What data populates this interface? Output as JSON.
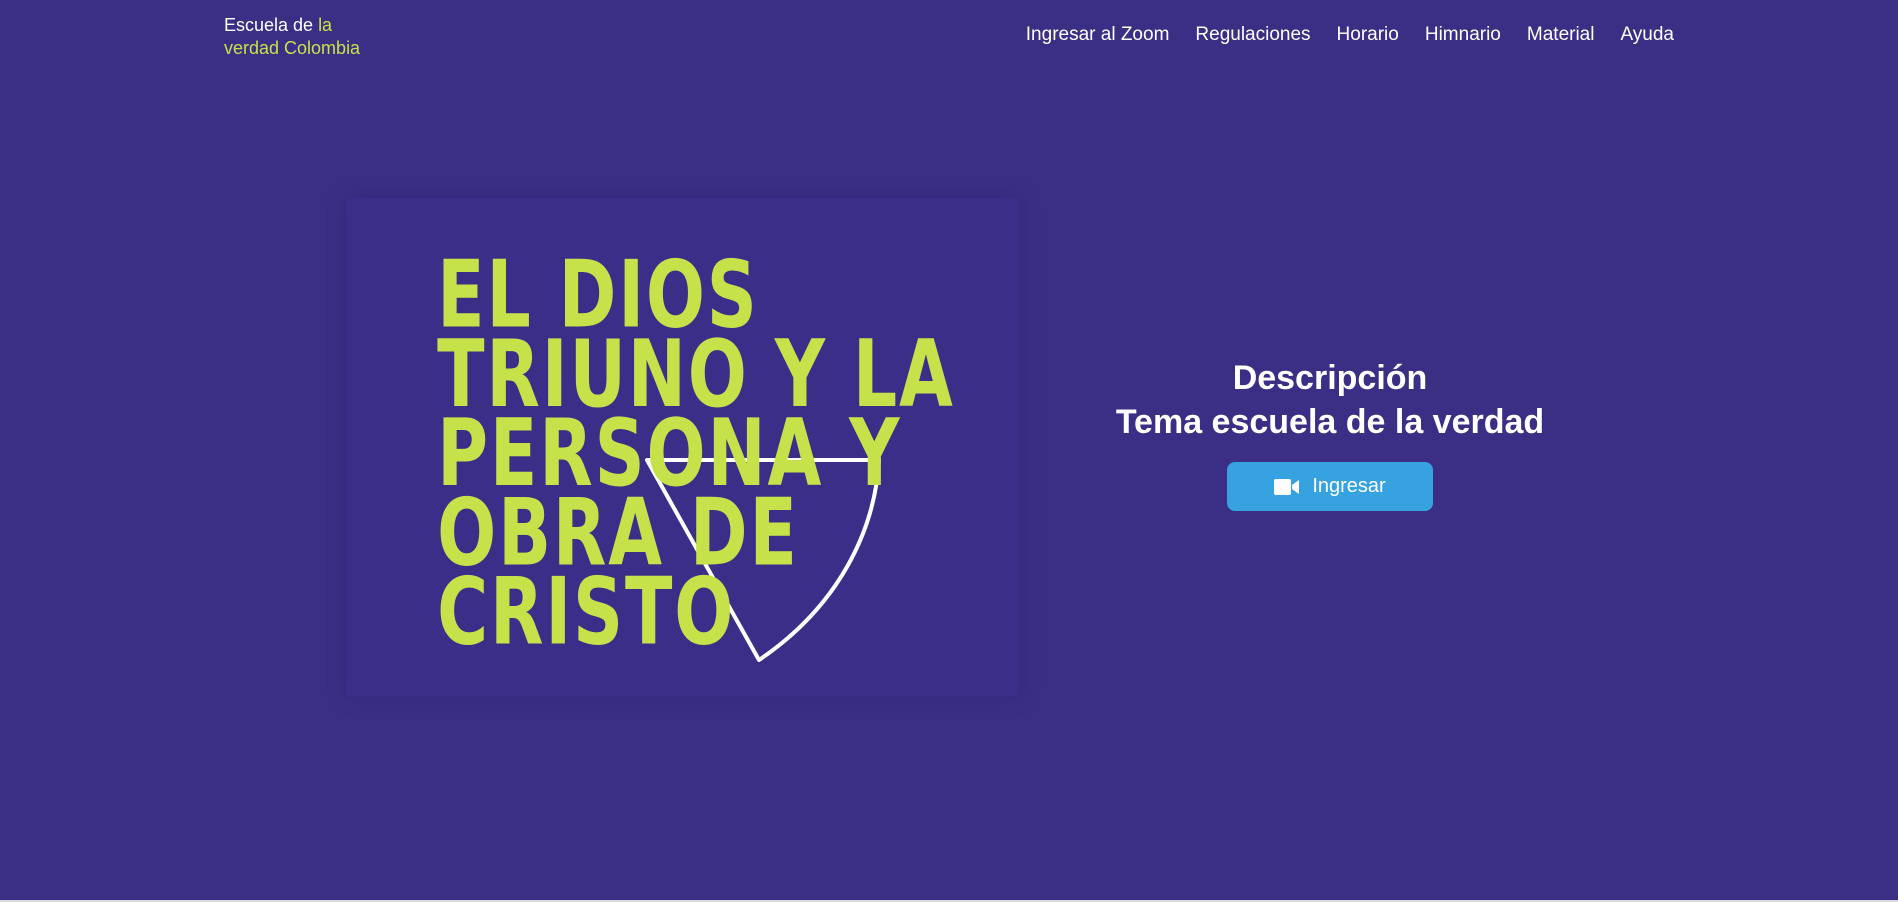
{
  "brand": {
    "part1": "Escuela de ",
    "part2": "la",
    "part3": "verdad Colombia",
    "accent_color": "#c6e24a"
  },
  "nav": {
    "items": [
      {
        "label": "Ingresar al Zoom"
      },
      {
        "label": "Regulaciones"
      },
      {
        "label": "Horario"
      },
      {
        "label": "Himnario"
      },
      {
        "label": "Material"
      },
      {
        "label": "Ayuda"
      }
    ]
  },
  "hero": {
    "image_lines": [
      "EL DIOS",
      "TRIUNO Y LA",
      "PERSONA Y",
      "OBRA DE",
      "CRISTO"
    ],
    "title": "Descripción",
    "subtitle": "Tema escuela de la verdad",
    "button_label": "Ingresar",
    "button_icon": "video-camera-icon"
  },
  "colors": {
    "background": "#3b2f85",
    "button": "#36a3e0",
    "image_text": "#c6e24a"
  }
}
